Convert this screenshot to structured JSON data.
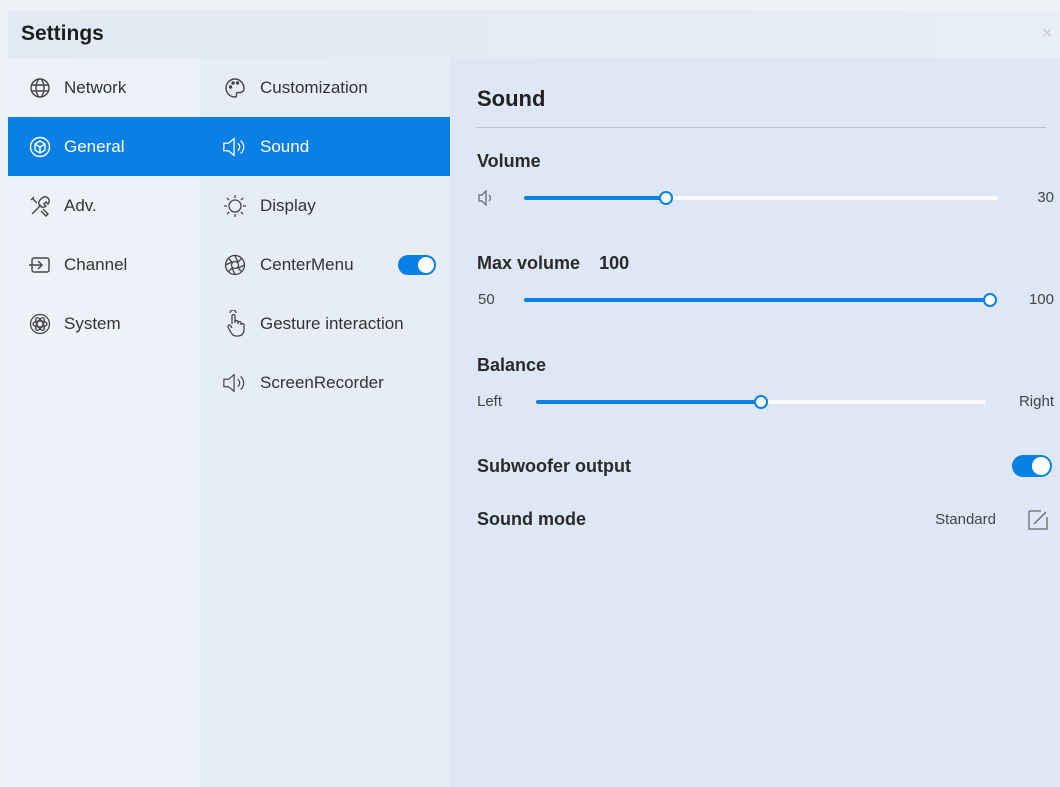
{
  "window": {
    "title": "Settings",
    "close_glyph": "×"
  },
  "categories": [
    {
      "id": "network",
      "label": "Network",
      "icon": "globe-icon",
      "active": false
    },
    {
      "id": "general",
      "label": "General",
      "icon": "cube-icon",
      "active": true
    },
    {
      "id": "adv",
      "label": "Adv.",
      "icon": "tools-icon",
      "active": false
    },
    {
      "id": "channel",
      "label": "Channel",
      "icon": "input-source-icon",
      "active": false
    },
    {
      "id": "system",
      "label": "System",
      "icon": "atom-icon",
      "active": false
    }
  ],
  "subcategories": [
    {
      "id": "customization",
      "label": "Customization",
      "icon": "palette-icon",
      "active": false
    },
    {
      "id": "sound",
      "label": "Sound",
      "icon": "speaker-icon",
      "active": true
    },
    {
      "id": "display",
      "label": "Display",
      "icon": "sun-icon",
      "active": false
    },
    {
      "id": "centermenu",
      "label": "CenterMenu",
      "icon": "aperture-icon",
      "active": false,
      "toggle_on": true
    },
    {
      "id": "gesture",
      "label": "Gesture interaction",
      "icon": "hand-pointer-icon",
      "active": false
    },
    {
      "id": "screenrecorder",
      "label": "ScreenRecorder",
      "icon": "speaker-icon",
      "active": false
    }
  ],
  "sound": {
    "title": "Sound",
    "volume": {
      "label": "Volume",
      "value": 30,
      "value_text": "30",
      "min": 0,
      "max": 100
    },
    "max_volume": {
      "label": "Max volume",
      "label_value": "100",
      "value": 100,
      "min": 50,
      "max": 100,
      "min_text": "50",
      "max_text": "100"
    },
    "balance": {
      "label": "Balance",
      "left_text": "Left",
      "right_text": "Right",
      "value": 0.5
    },
    "subwoofer": {
      "label": "Subwoofer output",
      "on": true
    },
    "sound_mode": {
      "label": "Sound mode",
      "value": "Standard"
    }
  },
  "colors": {
    "accent": "#0b80e4",
    "active_text": "#ffffff"
  }
}
